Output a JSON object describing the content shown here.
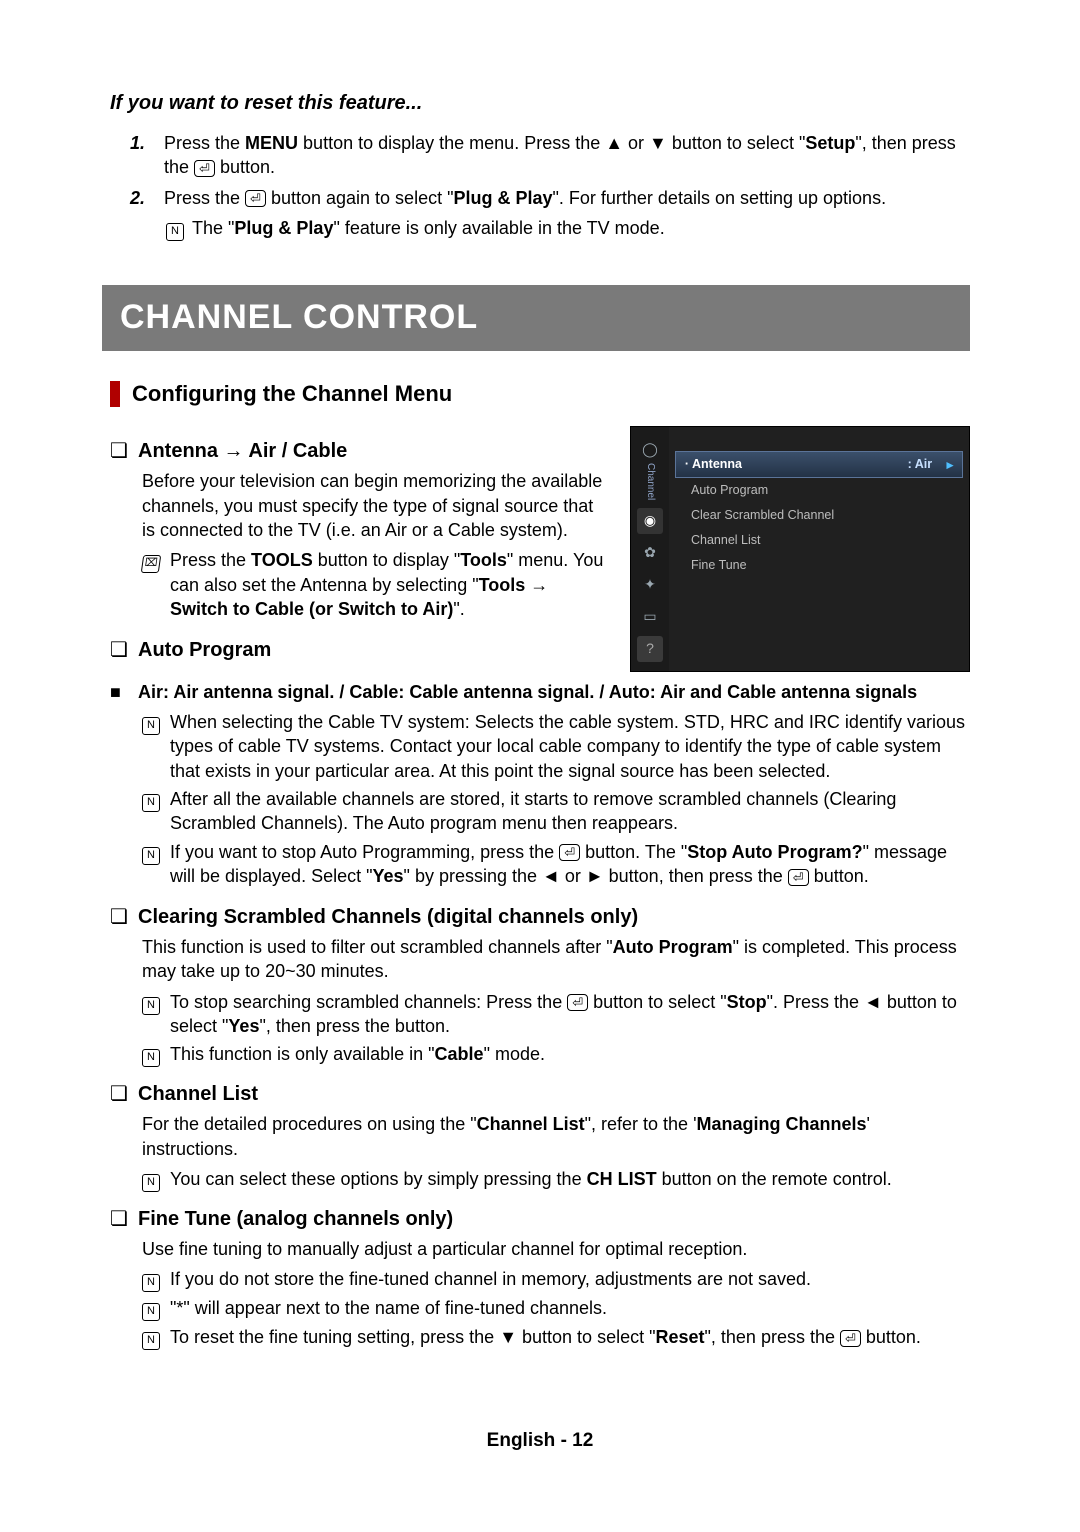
{
  "reset": {
    "heading": "If you want to reset this feature...",
    "step1_num": "1.",
    "step1_a": "Press the ",
    "step1_menu": "MENU",
    "step1_b": " button to display the menu. Press the ▲ or ▼ button to select \"",
    "step1_setup": "Setup",
    "step1_c": "\", then press the ",
    "step1_d": " button.",
    "step2_num": "2.",
    "step2_a": "Press the ",
    "step2_b": " button again to select \"",
    "step2_plug": "Plug & Play",
    "step2_c": "\". For further details on setting up options.",
    "note_a": "The \"",
    "note_plug": "Plug & Play",
    "note_b": "\" feature is only available in the TV mode."
  },
  "banner": "CHANNEL CONTROL",
  "h2": "Configuring the Channel Menu",
  "enter_glyph": "⏎",
  "note_glyph": "N",
  "tools_glyph": "⌧",
  "checkbox_glyph": "❏",
  "square_glyph": "■",
  "antenna": {
    "title": "Antenna → Air / Cable",
    "para": "Before your television can begin memorizing the available channels, you must specify the type of signal source that is connected to the TV (i.e. an Air or a Cable system).",
    "tools_a": "Press the ",
    "tools_tools": "TOOLS",
    "tools_b": " button to display \"",
    "tools_tools2": "Tools",
    "tools_c": "\" menu. You can also set the Antenna by selecting \"",
    "tools_phrase": "Tools → Switch to Cable (",
    "tools_or": "or Switch to Air)",
    "tools_d": "\"."
  },
  "autoprog": {
    "title": "Auto Program",
    "sub": "Air: Air antenna signal. / Cable: Cable antenna signal. / Auto: Air and Cable antenna signals",
    "n1": "When selecting the Cable TV system: Selects the cable system. STD, HRC and IRC identify various types of cable TV systems. Contact your local cable company to identify the type of cable system that exists in your particular area. At this point the signal source has been selected.",
    "n2": "After all the available channels are stored, it starts to remove scrambled channels (Clearing Scrambled Channels). The Auto program menu then reappears.",
    "n3_a": "If you want to stop Auto Programming, press the ",
    "n3_b": " button. The \"",
    "n3_stop": "Stop Auto Program?",
    "n3_c": "\" message will be displayed. Select \"",
    "n3_yes": "Yes",
    "n3_d": "\" by pressing the ◄ or ► button, then press the ",
    "n3_e": " button."
  },
  "clear": {
    "title": "Clearing Scrambled Channels (digital channels only)",
    "para_a": "This function is used to filter out scrambled channels after \"",
    "para_auto": "Auto Program",
    "para_b": "\" is completed. This process may take up to 20~30 minutes.",
    "n1_a": "To stop searching scrambled channels: Press the ",
    "n1_b": " button to select \"",
    "n1_stop": "Stop",
    "n1_c": "\". Press the ◄ button to select \"",
    "n1_yes": "Yes",
    "n1_d": "\", then press the  button.",
    "n2_a": "This function is only available in \"",
    "n2_cable": "Cable",
    "n2_b": "\" mode."
  },
  "chlist": {
    "title": "Channel List",
    "para_a": "For the detailed procedures on using the \"",
    "para_cl": "Channel List",
    "para_b": "\", refer to the '",
    "para_mc": "Managing Channels",
    "para_c": "' instructions.",
    "n1_a": "You can select these options by simply pressing the ",
    "n1_btn": "CH LIST",
    "n1_b": " button on the remote control."
  },
  "fine": {
    "title": "Fine Tune (analog channels only)",
    "para": "Use fine tuning to manually adjust a particular channel for optimal reception.",
    "n1": "If you do not store the fine-tuned channel in memory, adjustments are not saved.",
    "n2": "\"*\" will appear next to the name of fine-tuned channels.",
    "n3_a": "To reset the fine tuning setting, press the ▼ button to select \"",
    "n3_reset": "Reset",
    "n3_b": "\", then press the ",
    "n3_c": " button."
  },
  "osd": {
    "side_label": "Channel",
    "row1_label": "Antenna",
    "row1_value": ": Air",
    "row2": "Auto Program",
    "row3": "Clear Scrambled Channel",
    "row4": "Channel List",
    "row5": "Fine Tune"
  },
  "footer": "English - 12"
}
